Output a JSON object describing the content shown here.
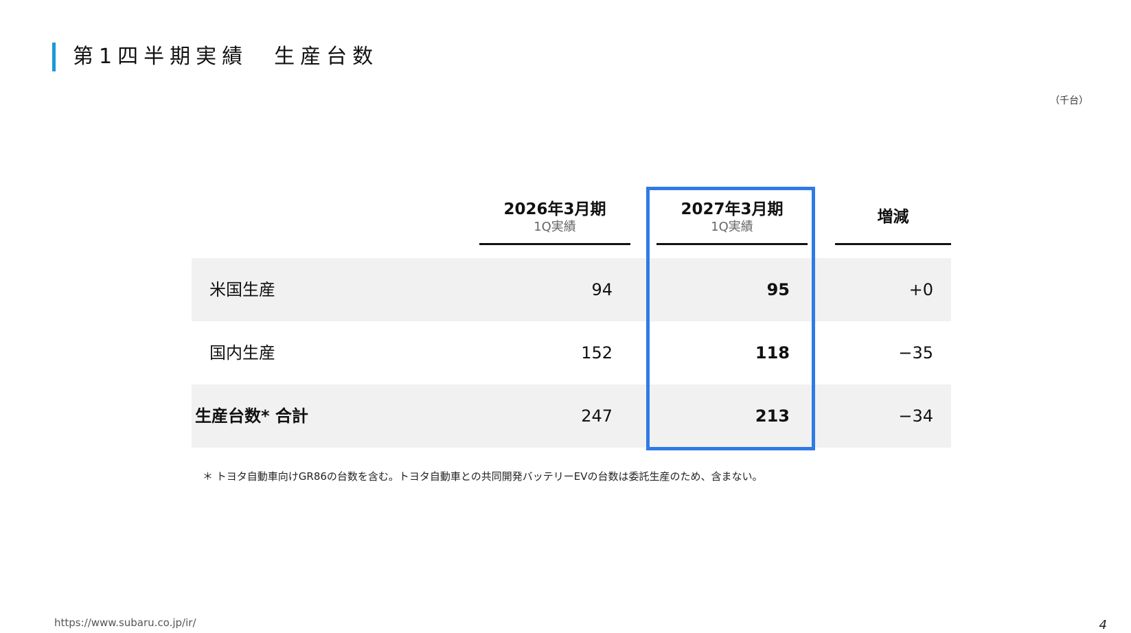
{
  "header": {
    "title": "第1四半期実績　生産台数",
    "unit": "（千台）"
  },
  "table": {
    "columns": [
      {
        "main": "2026年3月期",
        "sub": "1Q実績"
      },
      {
        "main": "2027年3月期",
        "sub": "1Q実績"
      },
      {
        "main": "増減",
        "sub": ""
      }
    ],
    "rows": [
      {
        "label": "米国生産",
        "prev": "94",
        "curr": "95",
        "diff": "+0"
      },
      {
        "label": "国内生産",
        "prev": "152",
        "curr": "118",
        "diff": "−35"
      },
      {
        "label": "生産台数* 合計",
        "prev": "247",
        "curr": "213",
        "diff": "−34"
      }
    ]
  },
  "footnote": "＊ トヨタ自動車向けGR86の台数を含む。トヨタ自動車との共同開発バッテリーEVの台数は委託生産のため、含まない。",
  "footer": {
    "url": "https://www.subaru.co.jp/ir/",
    "page": "4"
  },
  "colors": {
    "accent_bar": "#1a9ad6",
    "highlight_border": "#2f7ae5",
    "row_shade": "#f1f1f1"
  }
}
